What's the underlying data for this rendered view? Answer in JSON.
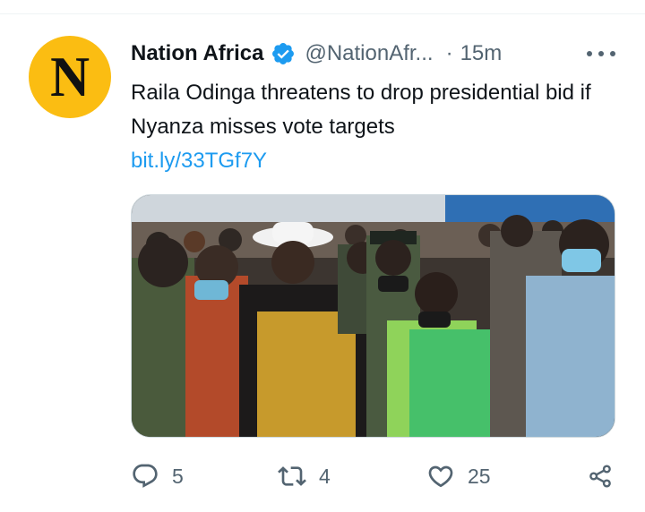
{
  "tweet": {
    "avatar_letter": "N",
    "author_name": "Nation Africa",
    "handle": "@NationAfr...",
    "separator": "·",
    "time": "15m",
    "text": "Raila Odinga threatens to drop presidential bid if Nyanza misses vote targets",
    "link": "bit.ly/33TGf7Y"
  },
  "actions": {
    "reply_count": "5",
    "retweet_count": "4",
    "like_count": "25"
  },
  "colors": {
    "avatar_bg": "#fbbd12",
    "verified_badge": "#1d9bf0",
    "link": "#1d9bf0",
    "secondary_text": "#536471"
  },
  "icons": {
    "verified": "verified-badge-icon",
    "more": "more-horizontal-icon",
    "reply": "reply-icon",
    "retweet": "retweet-icon",
    "like": "heart-icon",
    "share": "share-icon"
  }
}
